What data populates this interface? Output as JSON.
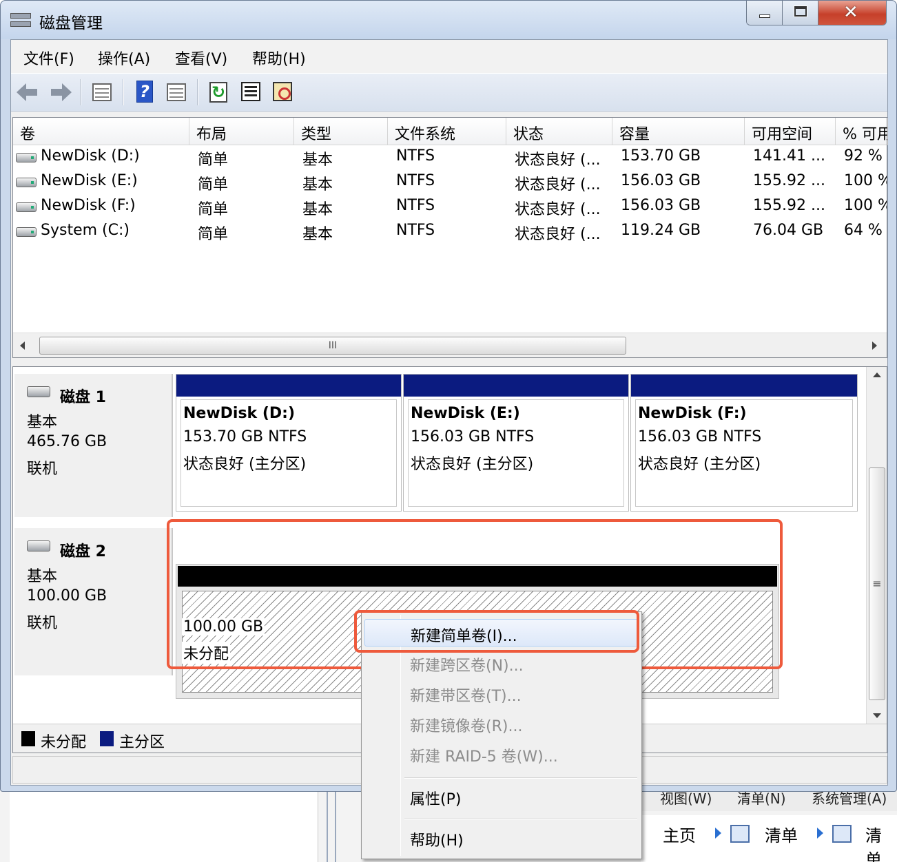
{
  "window": {
    "title": "磁盘管理"
  },
  "menubar": [
    "文件(F)",
    "操作(A)",
    "查看(V)",
    "帮助(H)"
  ],
  "toolbar": [
    "back-icon",
    "forward-icon",
    "console-tree-icon",
    "help-icon",
    "show-hide-icon",
    "refresh-icon",
    "properties-icon",
    "rescan-icon"
  ],
  "volume_list": {
    "columns": [
      "卷",
      "布局",
      "类型",
      "文件系统",
      "状态",
      "容量",
      "可用空间",
      "% 可用"
    ],
    "rows": [
      {
        "name": "NewDisk (D:)",
        "layout": "简单",
        "type": "基本",
        "fs": "NTFS",
        "status": "状态良好 (...",
        "capacity": "153.70 GB",
        "free": "141.41 ...",
        "pct": "92 %"
      },
      {
        "name": "NewDisk (E:)",
        "layout": "简单",
        "type": "基本",
        "fs": "NTFS",
        "status": "状态良好 (...",
        "capacity": "156.03 GB",
        "free": "155.92 ...",
        "pct": "100 %"
      },
      {
        "name": "NewDisk (F:)",
        "layout": "简单",
        "type": "基本",
        "fs": "NTFS",
        "status": "状态良好 (...",
        "capacity": "156.03 GB",
        "free": "155.92 ...",
        "pct": "100 %"
      },
      {
        "name": "System (C:)",
        "layout": "简单",
        "type": "基本",
        "fs": "NTFS",
        "status": "状态良好 (...",
        "capacity": "119.24 GB",
        "free": "76.04 GB",
        "pct": "64 %"
      }
    ],
    "scroll_thumb": "III"
  },
  "disks": [
    {
      "name": "磁盘 1",
      "kind": "基本",
      "size": "465.76 GB",
      "state": "联机",
      "partitions": [
        {
          "title": "NewDisk  (D:)",
          "size_fs": "153.70 GB NTFS",
          "status": "状态良好 (主分区)"
        },
        {
          "title": "NewDisk  (E:)",
          "size_fs": "156.03 GB NTFS",
          "status": "状态良好 (主分区)"
        },
        {
          "title": "NewDisk  (F:)",
          "size_fs": "156.03 GB NTFS",
          "status": "状态良好 (主分区)"
        }
      ]
    },
    {
      "name": "磁盘 2",
      "kind": "基本",
      "size": "100.00 GB",
      "state": "联机",
      "unallocated": {
        "size": "100.00 GB",
        "label": "未分配"
      }
    }
  ],
  "legend": [
    {
      "label": "未分配",
      "color": "#000000"
    },
    {
      "label": "主分区",
      "color": "#0b1b80"
    }
  ],
  "vscroll_thumb": "≡",
  "context_menu": {
    "items": [
      {
        "label": "新建简单卷(I)...",
        "enabled": true,
        "highlighted": true
      },
      {
        "label": "新建跨区卷(N)...",
        "enabled": false
      },
      {
        "label": "新建带区卷(T)...",
        "enabled": false
      },
      {
        "label": "新建镜像卷(R)...",
        "enabled": false
      },
      {
        "label": "新建 RAID-5 卷(W)...",
        "enabled": false
      },
      {
        "label": "属性(P)",
        "enabled": true
      },
      {
        "label": "帮助(H)",
        "enabled": true
      }
    ]
  },
  "background_window": {
    "menu": [
      "视图(W)",
      "清单(N)",
      "系统管理(A)"
    ],
    "nav": [
      "主页",
      "清单",
      "清单"
    ]
  },
  "colors": {
    "primary_partition": "#0b1b80",
    "highlight_box": "#ee5a3c"
  }
}
